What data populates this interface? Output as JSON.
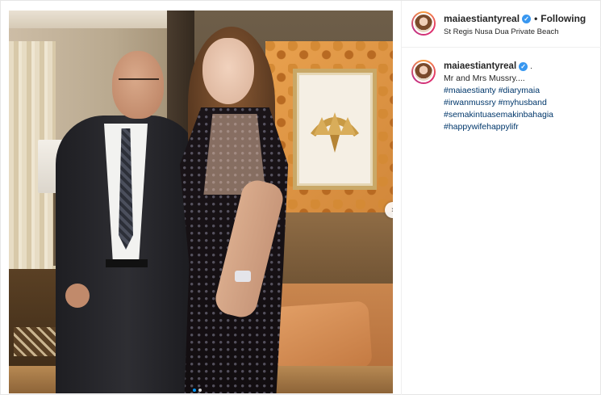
{
  "post": {
    "username": "maiaestiantyreal",
    "follow_separator": "•",
    "follow_status": "Following",
    "location": "St Regis Nusa Dua Private Beach",
    "next_icon": "›",
    "caption": {
      "trailing": ".",
      "text": "Mr and Mrs Mussry....",
      "hashtags": [
        "#maiaestianty #diarymaia",
        "#irwanmussry #myhusband",
        "#semakintuasemakinbahagia",
        "#happywifehappylifr"
      ]
    },
    "carousel": {
      "total": 2,
      "active": 1
    },
    "colors": {
      "verified": "#3897f0",
      "hashtag": "#00376b",
      "active_dot": "#0095f6"
    }
  }
}
